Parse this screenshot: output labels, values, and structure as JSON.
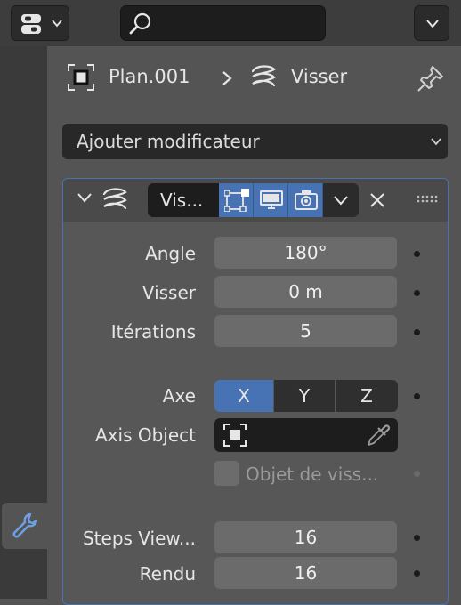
{
  "breadcrumb": {
    "object": "Plan.001",
    "modifier": "Visser"
  },
  "add_modifier": {
    "label": "Ajouter modificateur"
  },
  "modifier": {
    "name": "Vis...",
    "angle": {
      "label": "Angle",
      "value": "180°"
    },
    "screw": {
      "label": "Visser",
      "value": "0 m"
    },
    "iterations": {
      "label": "Itérations",
      "value": "5"
    },
    "axis": {
      "label": "Axe",
      "options": [
        "X",
        "Y",
        "Z"
      ],
      "selected": "X"
    },
    "axis_object": {
      "label": "Axis Object"
    },
    "object_screw": {
      "label": "Objet de viss..."
    },
    "steps_viewport": {
      "label": "Steps View...",
      "value": "16"
    },
    "render": {
      "label": "Rendu",
      "value": "16"
    }
  },
  "colors": {
    "accent": "#4772b3",
    "panel_bg": "#575757",
    "field_bg": "#6b6b6b",
    "sidebar_bg": "#3a3a3a"
  }
}
